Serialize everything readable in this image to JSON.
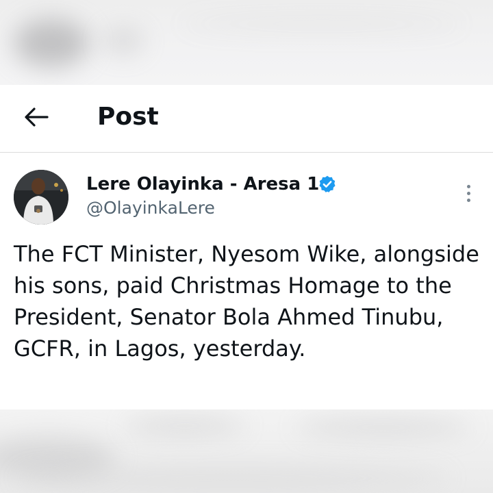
{
  "header": {
    "title": "Post",
    "back_icon": "arrow-left-icon"
  },
  "post": {
    "author_name": "Lere Olayinka - Aresa 1",
    "author_handle": "@OlayinkaLere",
    "verified": true,
    "verified_color": "#1d9bf0",
    "more_icon": "more-vertical-icon",
    "text": "The FCT Minister, Nyesom Wike, alongside his sons, paid Christmas Homage to the President, Senator Bola Ahmed Tinubu, GCFR, in Lagos, yesterday."
  },
  "colors": {
    "text_primary": "#0f1419",
    "text_secondary": "#536471",
    "background": "#ffffff"
  }
}
